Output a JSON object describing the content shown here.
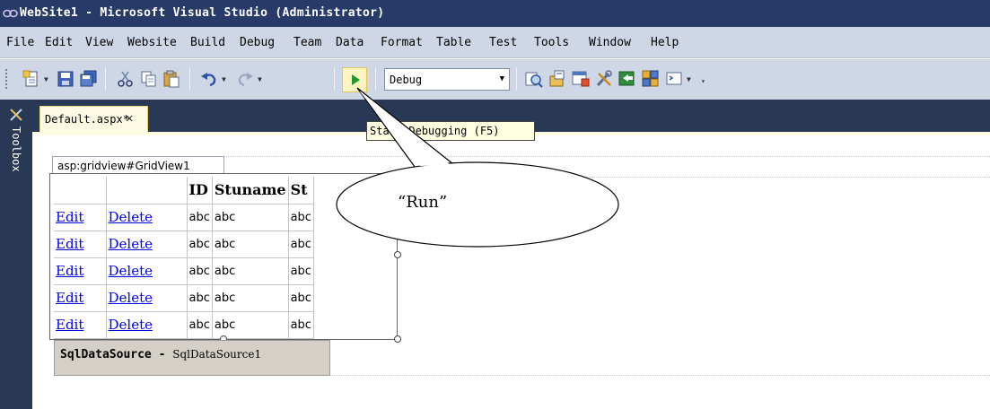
{
  "window": {
    "title": "WebSite1 - Microsoft Visual Studio (Administrator)"
  },
  "menu": {
    "items": [
      "File",
      "Edit",
      "View",
      "Website",
      "Build",
      "Debug",
      "Team",
      "Data",
      "Format",
      "Table",
      "Test",
      "Tools",
      "Window",
      "Help"
    ]
  },
  "toolbar": {
    "configuration": "Debug",
    "tooltip": "Start Debugging (F5)"
  },
  "toolbox": {
    "label": "Toolbox"
  },
  "document": {
    "tab_name": "Default.aspx*",
    "close_glyph": "✕"
  },
  "gridview": {
    "tag": "asp:gridview#GridView1",
    "columns": [
      "",
      "",
      "ID",
      "Stuname",
      "St"
    ],
    "rows": [
      [
        "Edit",
        "Delete",
        "abc",
        "abc",
        "abc"
      ],
      [
        "Edit",
        "Delete",
        "abc",
        "abc",
        "abc"
      ],
      [
        "Edit",
        "Delete",
        "abc",
        "abc",
        "abc"
      ],
      [
        "Edit",
        "Delete",
        "abc",
        "abc",
        "abc"
      ],
      [
        "Edit",
        "Delete",
        "abc",
        "abc",
        "abc"
      ]
    ]
  },
  "datasource": {
    "type_label": "SqlDataSource",
    "separator": " - ",
    "id": "SqlDataSource1"
  },
  "annotation": {
    "text": "“Run”"
  },
  "colors": {
    "titlebar": "#283b68",
    "menubar": "#cfd6e5",
    "dark_panel": "#293955",
    "link": "#0000ee"
  }
}
